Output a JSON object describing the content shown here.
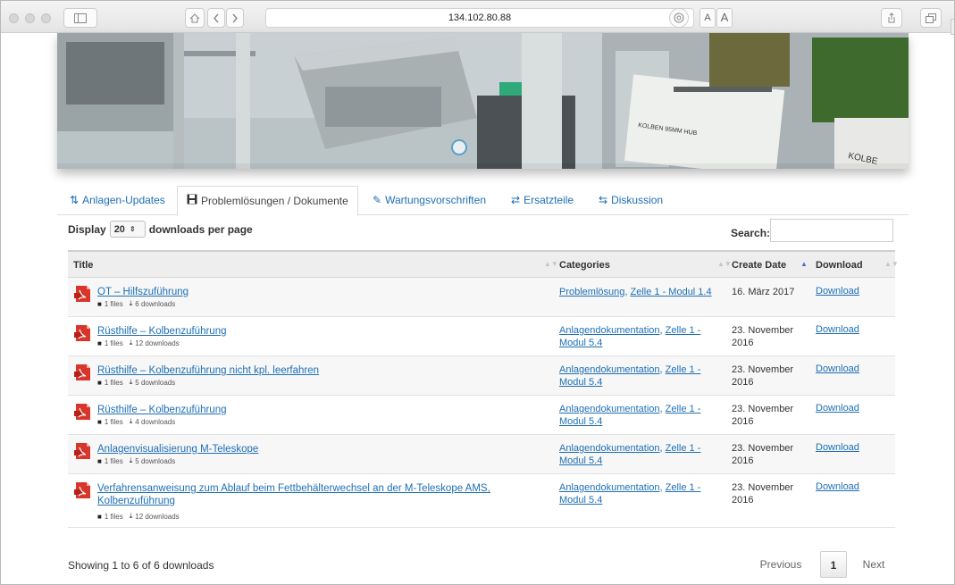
{
  "browser": {
    "url": "134.102.80.88",
    "text_smaller": "A",
    "text_larger": "A"
  },
  "tabs": [
    {
      "label": "Anlagen-Updates",
      "icon": "sort-amount-icon"
    },
    {
      "label": "Problemlösungen / Dokumente",
      "icon": "save-icon"
    },
    {
      "label": "Wartungsvorschriften",
      "icon": "pencil-icon"
    },
    {
      "label": "Ersatzteile",
      "icon": "exchange-icon"
    },
    {
      "label": "Diskussion",
      "icon": "retweet-icon"
    }
  ],
  "controls": {
    "display_label": "Display",
    "per_page": "20",
    "per_page_suffix": "downloads per page",
    "search_label": "Search:",
    "search_value": ""
  },
  "table": {
    "headers": [
      "Title",
      "Categories",
      "Create Date",
      "Download"
    ],
    "rows": [
      {
        "title": "OT – Hilfszuführung",
        "files": "1 files",
        "downloads": "6 downloads",
        "categories": [
          "Problemlösung",
          "Zelle 1 - Modul 1.4"
        ],
        "category_text": "Problemlösung, Zelle 1 - Modul 1.4",
        "date": "16. März 2017",
        "download": "Download"
      },
      {
        "title": "Rüsthilfe – Kolbenzuführung",
        "files": "1 files",
        "downloads": "12 downloads",
        "categories": [
          "Anlagendokumentation",
          "Zelle 1 - Modul 5.4"
        ],
        "category_text": "Anlagendokumentation, Zelle 1 - Modul 5.4",
        "date": "23. November 2016",
        "download": "Download"
      },
      {
        "title": "Rüsthilfe – Kolbenzuführung nicht kpl. leerfahren",
        "files": "1 files",
        "downloads": "5 downloads",
        "categories": [
          "Anlagendokumentation",
          "Zelle 1 - Modul 5.4"
        ],
        "category_text": "Anlagendokumentation, Zelle 1 - Modul 5.4",
        "date": "23. November 2016",
        "download": "Download"
      },
      {
        "title": "Rüsthilfe – Kolbenzuführung",
        "files": "1 files",
        "downloads": "4 downloads",
        "categories": [
          "Anlagendokumentation",
          "Zelle 1 - Modul 5.4"
        ],
        "category_text": "Anlagendokumentation, Zelle 1 - Modul 5.4",
        "date": "23. November 2016",
        "download": "Download"
      },
      {
        "title": "Anlagenvisualisierung M-Teleskope",
        "files": "1 files",
        "downloads": "5 downloads",
        "categories": [
          "Anlagendokumentation",
          "Zelle 1 - Modul 5.4"
        ],
        "category_text": "Anlagendokumentation, Zelle 1 - Modul 5.4",
        "date": "23. November 2016",
        "download": "Download"
      },
      {
        "title": "Verfahrensanweisung zum Ablauf beim Fettbehälterwechsel an der M-Teleskope AMS, Kolbenzuführung",
        "files": "1 files",
        "downloads": "12 downloads",
        "categories": [
          "Anlagendokumentation",
          "Zelle 1 - Modul 5.4"
        ],
        "category_text": "Anlagendokumentation, Zelle 1 - Modul 5.4",
        "date": "23. November 2016",
        "download": "Download"
      }
    ]
  },
  "footer": {
    "showing": "Showing 1 to 6 of 6 downloads",
    "previous": "Previous",
    "page": "1",
    "next": "Next"
  },
  "hero": {
    "label_1": "KOLBEN 95MM HUB",
    "label_2": "KOLBE"
  }
}
